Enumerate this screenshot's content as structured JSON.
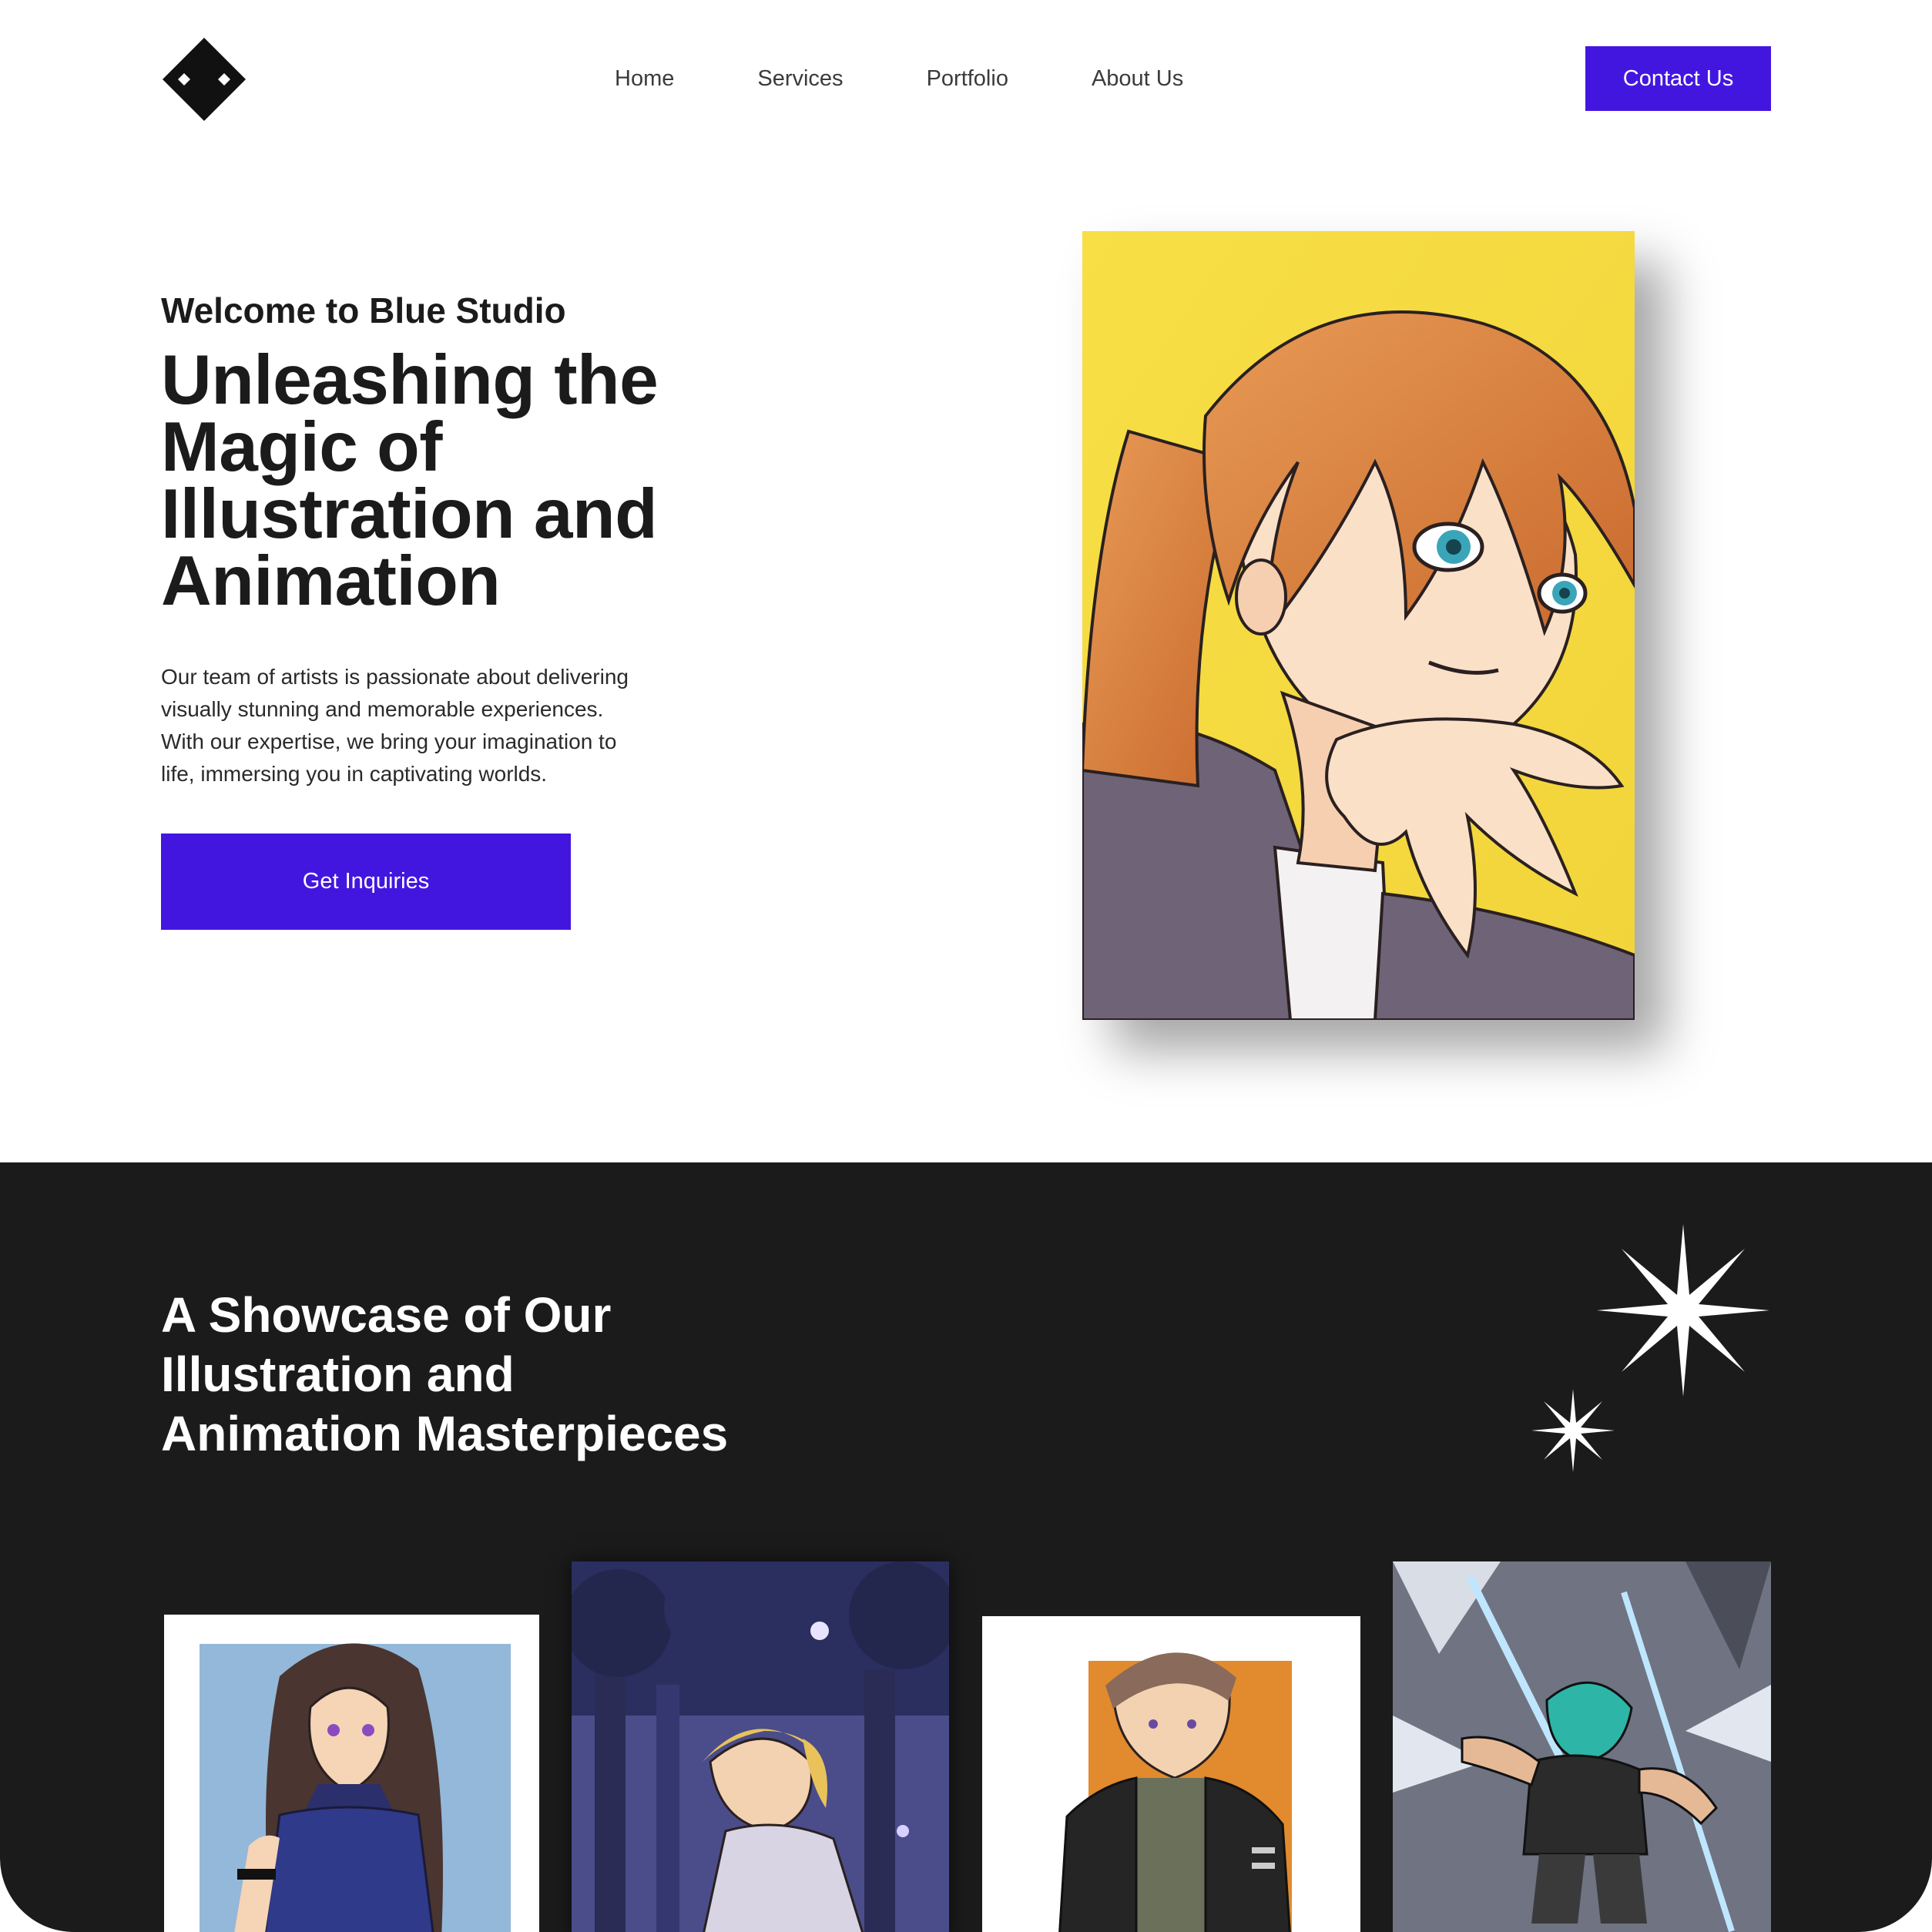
{
  "brand": {
    "logo_icon": "diamond-logo-icon"
  },
  "nav": {
    "items": [
      {
        "label": "Home"
      },
      {
        "label": "Services"
      },
      {
        "label": "Portfolio"
      },
      {
        "label": "About Us"
      }
    ],
    "contact_label": "Contact Us"
  },
  "hero": {
    "eyebrow": "Welcome to Blue Studio",
    "title_lines": [
      "Unleashing the",
      "Magic of",
      "Illustration and",
      "Animation"
    ],
    "description_lines": [
      "Our team of artists is passionate about delivering",
      "visually stunning and memorable experiences.",
      "With our expertise, we bring your imagination to",
      "life, immersing you in captivating worlds."
    ],
    "cta_label": "Get Inquiries",
    "image_icon": "anime-girl-illustration"
  },
  "showcase": {
    "title_lines": [
      "A Showcase of Our",
      "Illustration and",
      "Animation Masterpieces"
    ],
    "decor_icons": [
      "sparkle-large-icon",
      "sparkle-small-icon"
    ],
    "cards": [
      {
        "icon": "long-haired-warrior-illustration"
      },
      {
        "icon": "night-forest-girl-illustration"
      },
      {
        "icon": "jacket-boy-illustration"
      },
      {
        "icon": "action-slash-illustration"
      }
    ]
  },
  "colors": {
    "accent": "#4316e0",
    "text_dark": "#1b1b1b",
    "dark_section": "#1b1b1b",
    "white": "#ffffff",
    "hero_bg_yellow": "#f7df45"
  }
}
